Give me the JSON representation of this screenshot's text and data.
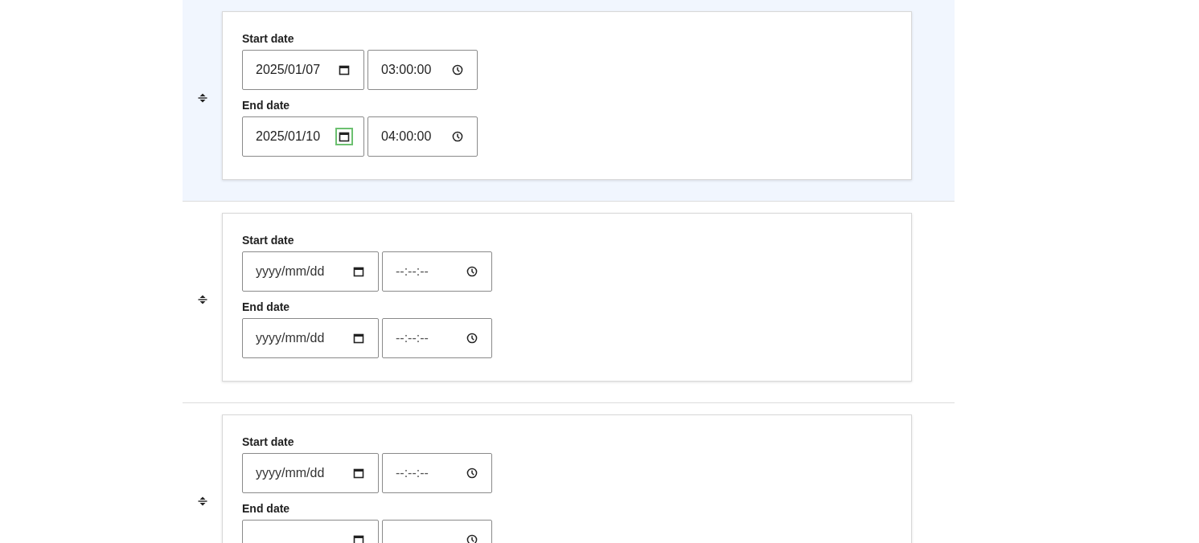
{
  "rows": [
    {
      "selected": true,
      "fields": [
        {
          "label": "Start date",
          "date": {
            "value": "2025/01/07",
            "picker_focused": false
          },
          "time": {
            "value": "03:00:00"
          }
        },
        {
          "label": "End date",
          "date": {
            "value": "2025/01/10",
            "picker_focused": true
          },
          "time": {
            "value": "04:00:00"
          }
        }
      ]
    },
    {
      "selected": false,
      "fields": [
        {
          "label": "Start date",
          "date": {
            "placeholder": "yyyy/mm/dd",
            "picker_focused": false
          },
          "time": {
            "placeholder": "--:--:--"
          }
        },
        {
          "label": "End date",
          "date": {
            "placeholder": "yyyy/mm/dd",
            "picker_focused": false
          },
          "time": {
            "placeholder": "--:--:--"
          }
        }
      ]
    },
    {
      "selected": false,
      "fields": [
        {
          "label": "Start date",
          "date": {
            "placeholder": "yyyy/mm/dd",
            "picker_focused": false
          },
          "time": {
            "placeholder": "--:--:--"
          }
        },
        {
          "label": "End date",
          "date": {
            "picker_focused": false
          }
        }
      ]
    }
  ]
}
